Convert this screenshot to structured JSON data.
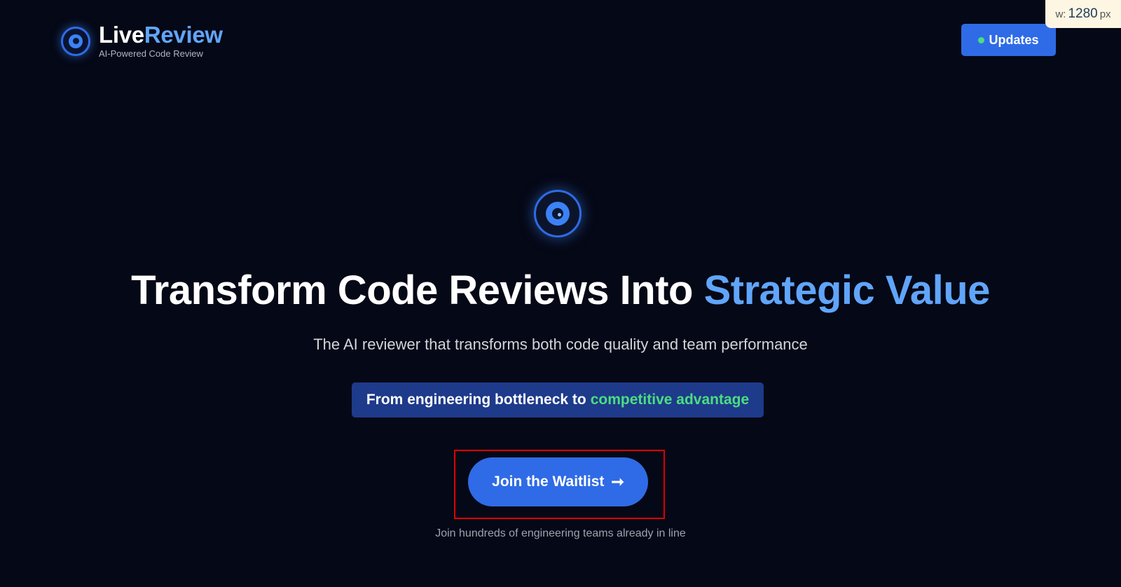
{
  "header": {
    "brand_part1": "Live",
    "brand_part2": "Review",
    "tagline": "AI-Powered Code Review",
    "logo_icon": "eye-icon",
    "updates_label": "Updates",
    "updates_dot_color": "#4ade80"
  },
  "width_badge": {
    "prefix": "w:",
    "value": "1280",
    "unit": "px"
  },
  "hero": {
    "icon": "eye-icon",
    "headline_main": "Transform Code Reviews Into ",
    "headline_accent": "Strategic Value",
    "subtitle": "The AI reviewer that transforms both code quality and team performance",
    "banner_text": "From engineering bottleneck to",
    "banner_accent": "competitive advantage",
    "cta_label": "Join the Waitlist",
    "cta_icon": "arrow-right-icon",
    "cta_note": "Join hundreds of engineering teams already in line"
  },
  "colors": {
    "background": "#050816",
    "accent_blue": "#60a5fa",
    "button_blue": "#2f6be6",
    "accent_green": "#4ade80",
    "highlight_red": "#e00000"
  }
}
